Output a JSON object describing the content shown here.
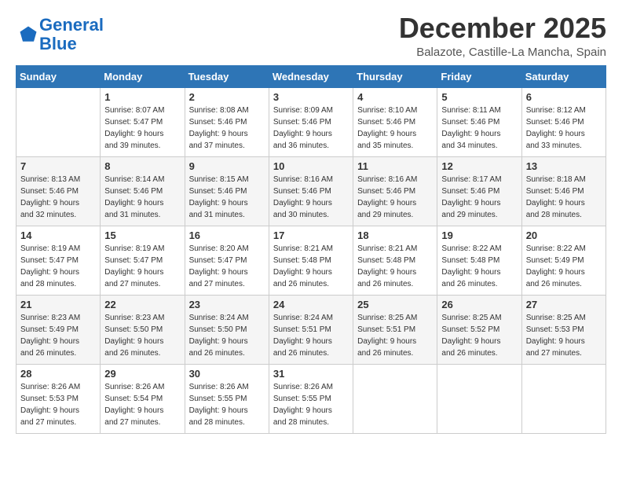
{
  "header": {
    "logo_line1": "General",
    "logo_line2": "Blue",
    "month_title": "December 2025",
    "subtitle": "Balazote, Castille-La Mancha, Spain"
  },
  "weekdays": [
    "Sunday",
    "Monday",
    "Tuesday",
    "Wednesday",
    "Thursday",
    "Friday",
    "Saturday"
  ],
  "weeks": [
    [
      {
        "day": "",
        "info": ""
      },
      {
        "day": "1",
        "info": "Sunrise: 8:07 AM\nSunset: 5:47 PM\nDaylight: 9 hours\nand 39 minutes."
      },
      {
        "day": "2",
        "info": "Sunrise: 8:08 AM\nSunset: 5:46 PM\nDaylight: 9 hours\nand 37 minutes."
      },
      {
        "day": "3",
        "info": "Sunrise: 8:09 AM\nSunset: 5:46 PM\nDaylight: 9 hours\nand 36 minutes."
      },
      {
        "day": "4",
        "info": "Sunrise: 8:10 AM\nSunset: 5:46 PM\nDaylight: 9 hours\nand 35 minutes."
      },
      {
        "day": "5",
        "info": "Sunrise: 8:11 AM\nSunset: 5:46 PM\nDaylight: 9 hours\nand 34 minutes."
      },
      {
        "day": "6",
        "info": "Sunrise: 8:12 AM\nSunset: 5:46 PM\nDaylight: 9 hours\nand 33 minutes."
      }
    ],
    [
      {
        "day": "7",
        "info": "Sunrise: 8:13 AM\nSunset: 5:46 PM\nDaylight: 9 hours\nand 32 minutes."
      },
      {
        "day": "8",
        "info": "Sunrise: 8:14 AM\nSunset: 5:46 PM\nDaylight: 9 hours\nand 31 minutes."
      },
      {
        "day": "9",
        "info": "Sunrise: 8:15 AM\nSunset: 5:46 PM\nDaylight: 9 hours\nand 31 minutes."
      },
      {
        "day": "10",
        "info": "Sunrise: 8:16 AM\nSunset: 5:46 PM\nDaylight: 9 hours\nand 30 minutes."
      },
      {
        "day": "11",
        "info": "Sunrise: 8:16 AM\nSunset: 5:46 PM\nDaylight: 9 hours\nand 29 minutes."
      },
      {
        "day": "12",
        "info": "Sunrise: 8:17 AM\nSunset: 5:46 PM\nDaylight: 9 hours\nand 29 minutes."
      },
      {
        "day": "13",
        "info": "Sunrise: 8:18 AM\nSunset: 5:46 PM\nDaylight: 9 hours\nand 28 minutes."
      }
    ],
    [
      {
        "day": "14",
        "info": "Sunrise: 8:19 AM\nSunset: 5:47 PM\nDaylight: 9 hours\nand 28 minutes."
      },
      {
        "day": "15",
        "info": "Sunrise: 8:19 AM\nSunset: 5:47 PM\nDaylight: 9 hours\nand 27 minutes."
      },
      {
        "day": "16",
        "info": "Sunrise: 8:20 AM\nSunset: 5:47 PM\nDaylight: 9 hours\nand 27 minutes."
      },
      {
        "day": "17",
        "info": "Sunrise: 8:21 AM\nSunset: 5:48 PM\nDaylight: 9 hours\nand 26 minutes."
      },
      {
        "day": "18",
        "info": "Sunrise: 8:21 AM\nSunset: 5:48 PM\nDaylight: 9 hours\nand 26 minutes."
      },
      {
        "day": "19",
        "info": "Sunrise: 8:22 AM\nSunset: 5:48 PM\nDaylight: 9 hours\nand 26 minutes."
      },
      {
        "day": "20",
        "info": "Sunrise: 8:22 AM\nSunset: 5:49 PM\nDaylight: 9 hours\nand 26 minutes."
      }
    ],
    [
      {
        "day": "21",
        "info": "Sunrise: 8:23 AM\nSunset: 5:49 PM\nDaylight: 9 hours\nand 26 minutes."
      },
      {
        "day": "22",
        "info": "Sunrise: 8:23 AM\nSunset: 5:50 PM\nDaylight: 9 hours\nand 26 minutes."
      },
      {
        "day": "23",
        "info": "Sunrise: 8:24 AM\nSunset: 5:50 PM\nDaylight: 9 hours\nand 26 minutes."
      },
      {
        "day": "24",
        "info": "Sunrise: 8:24 AM\nSunset: 5:51 PM\nDaylight: 9 hours\nand 26 minutes."
      },
      {
        "day": "25",
        "info": "Sunrise: 8:25 AM\nSunset: 5:51 PM\nDaylight: 9 hours\nand 26 minutes."
      },
      {
        "day": "26",
        "info": "Sunrise: 8:25 AM\nSunset: 5:52 PM\nDaylight: 9 hours\nand 26 minutes."
      },
      {
        "day": "27",
        "info": "Sunrise: 8:25 AM\nSunset: 5:53 PM\nDaylight: 9 hours\nand 27 minutes."
      }
    ],
    [
      {
        "day": "28",
        "info": "Sunrise: 8:26 AM\nSunset: 5:53 PM\nDaylight: 9 hours\nand 27 minutes."
      },
      {
        "day": "29",
        "info": "Sunrise: 8:26 AM\nSunset: 5:54 PM\nDaylight: 9 hours\nand 27 minutes."
      },
      {
        "day": "30",
        "info": "Sunrise: 8:26 AM\nSunset: 5:55 PM\nDaylight: 9 hours\nand 28 minutes."
      },
      {
        "day": "31",
        "info": "Sunrise: 8:26 AM\nSunset: 5:55 PM\nDaylight: 9 hours\nand 28 minutes."
      },
      {
        "day": "",
        "info": ""
      },
      {
        "day": "",
        "info": ""
      },
      {
        "day": "",
        "info": ""
      }
    ]
  ]
}
